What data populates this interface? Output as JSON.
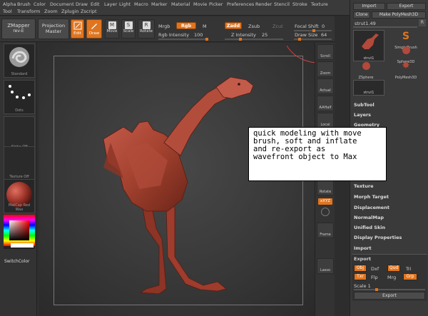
{
  "menu": [
    "Alpha",
    "Brush",
    "Color",
    "Document",
    "Draw",
    "Edit",
    "Layer",
    "Light",
    "Macro",
    "Marker",
    "Material",
    "Movie",
    "Picker",
    "Preferences",
    "Render",
    "Stencil",
    "Stroke",
    "Texture",
    "Tool",
    "Transform",
    "Zoom",
    "Zplugin",
    "Zscript"
  ],
  "toolbar": {
    "zmapper": "ZMapper",
    "zmapper_sub": "rev-E",
    "projection": "Projection",
    "projection_sub": "Master",
    "edit": "Edit",
    "draw": "Draw",
    "move": "Move",
    "scale": "Scale",
    "rotate": "Rotate",
    "mrgb": "Mrgb",
    "rgb": "Rgb",
    "m": "M",
    "rgb_intensity_label": "Rgb Intensity",
    "rgb_intensity_value": "100",
    "zadd": "Zadd",
    "zsub": "Zsub",
    "zcut": "Zcut",
    "z_intensity_label": "Z Intensity",
    "z_intensity_value": "25",
    "focal_shift_label": "Focal Shift",
    "focal_shift_value": "0",
    "draw_size_label": "Draw Size",
    "draw_size_value": "64"
  },
  "left_panel": [
    {
      "name": "brush-thumb",
      "label": "Standard"
    },
    {
      "name": "stroke-thumb",
      "label": "Dots"
    },
    {
      "name": "alpha-thumb",
      "label": "Alpha Off"
    },
    {
      "name": "texture-thumb",
      "label": "Texture Off"
    },
    {
      "name": "material-thumb",
      "label": "MatCap Red Wax"
    }
  ],
  "switch_color": "SwitchColor",
  "right_strip": [
    "Scroll",
    "Zoom",
    "Actual",
    "AAHalf",
    "Local",
    "Rotate",
    "Frame",
    "Lasso"
  ],
  "right_strip_xyz": "xXYZ",
  "tray": {
    "import": "Import",
    "export": "Export",
    "clone": "Clone",
    "make_polymesh": "Make PolyMesh3D",
    "tool_name": "strut1.49",
    "r_button": "R",
    "tools": [
      "strut1",
      "SimpleBrush",
      "Sphere3D",
      "ZSphere",
      "PolyMesh3D",
      "strut1"
    ],
    "sections": [
      "SubTool",
      "Layers",
      "Geometry",
      "Texture",
      "Morph Target",
      "Displacement",
      "NormalMap",
      "Unified Skin",
      "Display Properties",
      "Import"
    ],
    "export_section": "Export",
    "export_opts_1": [
      "Obj",
      "Dxf",
      "Qud",
      "Tri"
    ],
    "export_opts_2": [
      "Txr",
      "Flp",
      "Mrg",
      "Grp"
    ],
    "scale_label": "Scale",
    "scale_value": "1",
    "export_button": "Export"
  },
  "overlay_lines": [
    "quick modeling with move",
    "brush, soft and inflate",
    "and re-export as",
    "wavefront object to Max"
  ],
  "colors": {
    "accent": "#e0751f",
    "mesh": "#b3493b"
  }
}
